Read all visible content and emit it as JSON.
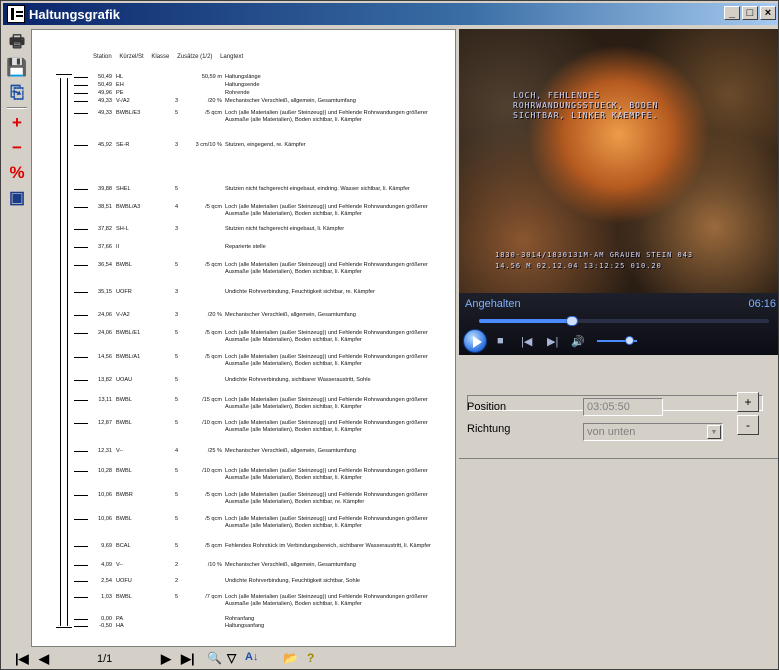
{
  "window": {
    "title": "Haltungsgrafik"
  },
  "toolbar_left": [
    {
      "icon": "printer-icon",
      "glyph": "🖶",
      "color": "#333333"
    },
    {
      "icon": "save-icon",
      "glyph": "💾",
      "color": "#333333"
    },
    {
      "icon": "copy-icon",
      "glyph": "⎘",
      "color": "#1a4fa8"
    },
    {
      "icon": "plus-icon",
      "glyph": "+",
      "color": "#e00000"
    },
    {
      "icon": "minus-icon",
      "glyph": "−",
      "color": "#e00000"
    },
    {
      "icon": "percent-icon",
      "glyph": "%",
      "color": "#e00000"
    },
    {
      "icon": "frame-icon",
      "glyph": "▣",
      "color": "#1a3a8a"
    }
  ],
  "report": {
    "headers": {
      "station": "Station",
      "kuerzel": "Kürzel/St",
      "klasse": "Klasse",
      "zusatz": "Zusätze (1/2)",
      "langtext": "Langtext"
    },
    "rows": [
      {
        "st": "50,49",
        "code": "HL",
        "kl": "",
        "zu": "50,59 m",
        "txt": "Haltungslänge"
      },
      {
        "st": "50,49",
        "code": "EH",
        "kl": "",
        "zu": "",
        "txt": "Haltungsende"
      },
      {
        "st": "49,96",
        "code": "PE",
        "kl": "",
        "zu": "",
        "txt": "Rohrende"
      },
      {
        "st": "49,33",
        "code": "V-/A2",
        "kl": "3",
        "zu": "/20 %",
        "txt": "Mechanischer Verschleiß, allgemein, Gesamtumfang"
      },
      {
        "st": "49,33",
        "code": "BWBL/E3",
        "kl": "5",
        "zu": "/5 qcm",
        "txt": "Loch (alle Materialien (außer Steinzeug)) und Fehlende Rohrwandungen größerer Ausmaße (alle Materialien), Boden sichtbar, li. Kämpfer"
      },
      {
        "st": "45,92",
        "code": "SE-R",
        "kl": "3",
        "zu": "3 cm/10 %",
        "txt": "Stutzen, eingegend, re. Kämpfer"
      },
      {
        "st": "39,88",
        "code": "SHEL",
        "kl": "5",
        "zu": "",
        "txt": "Stutzen nicht fachgerecht eingebaut, eindring. Wasser sichtbar, li. Kämpfer"
      },
      {
        "st": "38,51",
        "code": "BWBL/A3",
        "kl": "4",
        "zu": "/5 qcm",
        "txt": "Loch (alle Materialien (außer Steinzeug)) und Fehlende Rohrwandungen größerer Ausmaße (alle Materialien), Boden sichtbar, li. Kämpfer"
      },
      {
        "st": "37,82",
        "code": "SH-L",
        "kl": "3",
        "zu": "",
        "txt": "Stutzen nicht fachgerecht eingebaut, li. Kämpfer"
      },
      {
        "st": "37,66",
        "code": "II",
        "kl": "",
        "zu": "",
        "txt": "Reparierte stelle"
      },
      {
        "st": "36,54",
        "code": "BWBL",
        "kl": "5",
        "zu": "/5 qcm",
        "txt": "Loch (alle Materialien (außer Steinzeug)) und Fehlende Rohrwandungen größerer Ausmaße (alle Materialien), Boden sichtbar, li. Kämpfer"
      },
      {
        "st": "35,15",
        "code": "UOFR",
        "kl": "3",
        "zu": "",
        "txt": "Undichte Rohrverbindung, Feuchtigkeit sichtbar, re. Kämpfer"
      },
      {
        "st": "24,06",
        "code": "V-/A2",
        "kl": "3",
        "zu": "/20 %",
        "txt": "Mechanischer Verschleiß, allgemein, Gesamtumfang"
      },
      {
        "st": "24,06",
        "code": "BWBL/E1",
        "kl": "5",
        "zu": "/5 qcm",
        "txt": "Loch (alle Materialien (außer Steinzeug)) und Fehlende Rohrwandungen größerer Ausmaße (alle Materialien), Boden sichtbar, li. Kämpfer"
      },
      {
        "st": "14,56",
        "code": "BWBL/A1",
        "kl": "5",
        "zu": "/5 qcm",
        "txt": "Loch (alle Materialien (außer Steinzeug)) und Fehlende Rohrwandungen größerer Ausmaße (alle Materialien), Boden sichtbar, li. Kämpfer"
      },
      {
        "st": "13,82",
        "code": "UOAU",
        "kl": "5",
        "zu": "",
        "txt": "Undichte Rohrverbindung, sichtbarer Wasseraustritt, Sohle"
      },
      {
        "st": "13,11",
        "code": "BWBL",
        "kl": "5",
        "zu": "/15 qcm",
        "txt": "Loch (alle Materialien (außer Steinzeug)) und Fehlende Rohrwandungen größerer Ausmaße (alle Materialien), Boden sichtbar, li. Kämpfer"
      },
      {
        "st": "12,87",
        "code": "BWBL",
        "kl": "5",
        "zu": "/10 qcm",
        "txt": "Loch (alle Materialien (außer Steinzeug)) und Fehlende Rohrwandungen größerer Ausmaße (alle Materialien), Boden sichtbar, li. Kämpfer"
      },
      {
        "st": "12,31",
        "code": "V--",
        "kl": "4",
        "zu": "/25 %",
        "txt": "Mechanischer Verschleiß, allgemein, Gesamtumfang"
      },
      {
        "st": "10,28",
        "code": "BWBL",
        "kl": "5",
        "zu": "/10 qcm",
        "txt": "Loch (alle Materialien (außer Steinzeug)) und Fehlende Rohrwandungen größerer Ausmaße (alle Materialien), Boden sichtbar, li. Kämpfer"
      },
      {
        "st": "10,06",
        "code": "BWBR",
        "kl": "5",
        "zu": "/5 qcm",
        "txt": "Loch (alle Materialien (außer Steinzeug)) und Fehlende Rohrwandungen größerer Ausmaße (alle Materialien), Boden sichtbar, re. Kämpfer"
      },
      {
        "st": "10,06",
        "code": "BWBL",
        "kl": "5",
        "zu": "/5 qcm",
        "txt": "Loch (alle Materialien (außer Steinzeug)) und Fehlende Rohrwandungen größerer Ausmaße (alle Materialien), Boden sichtbar, li. Kämpfer"
      },
      {
        "st": "9,69",
        "code": "BCAL",
        "kl": "5",
        "zu": "/5 qcm",
        "txt": "Fehlendes Rohrstück im Verbindungsbereich, sichtbarer Wasseraustritt, li. Kämpfer"
      },
      {
        "st": "4,09",
        "code": "V--",
        "kl": "2",
        "zu": "/10 %",
        "txt": "Mechanischer Verschleiß, allgemein, Gesamtumfang"
      },
      {
        "st": "2,54",
        "code": "UOFU",
        "kl": "2",
        "zu": "",
        "txt": "Undichte Rohrverbindung, Feuchtigkeit sichtbar, Sohle"
      },
      {
        "st": "1,03",
        "code": "BWBL",
        "kl": "5",
        "zu": "/7 qcm",
        "txt": "Loch (alle Materialien (außer Steinzeug)) und Fehlende Rohrwandungen größerer Ausmaße (alle Materialien), Boden sichtbar, li. Kämpfer"
      },
      {
        "st": "0,00",
        "code": "PA",
        "kl": "",
        "zu": "",
        "txt": "Rohranfang"
      },
      {
        "st": "-0,50",
        "code": "HA",
        "kl": "",
        "zu": "",
        "txt": "Haltungsanfang"
      }
    ]
  },
  "video": {
    "overlay_top": [
      "LOCH, FEHLENDES",
      "ROHRWANDUNGSSTUECK, BODEN",
      "SICHTBAR, LINKER KAEMPFE."
    ],
    "overlay_bottom": [
      "1830-3014/1830131M-AM GRAUEN STEIN 043",
      "14.56 M   02.12.04  13:12:25    010.20"
    ]
  },
  "player": {
    "status": "Angehalten",
    "time": "06:16",
    "progress": 0.32,
    "volume": 0.45
  },
  "panel": {
    "position_label": "Position",
    "position_value": "03:05:50",
    "richtung_label": "Richtung",
    "richtung_value": "von unten",
    "plus": "+",
    "minus": "-"
  },
  "bottom": {
    "page_indicator": "1/1"
  }
}
